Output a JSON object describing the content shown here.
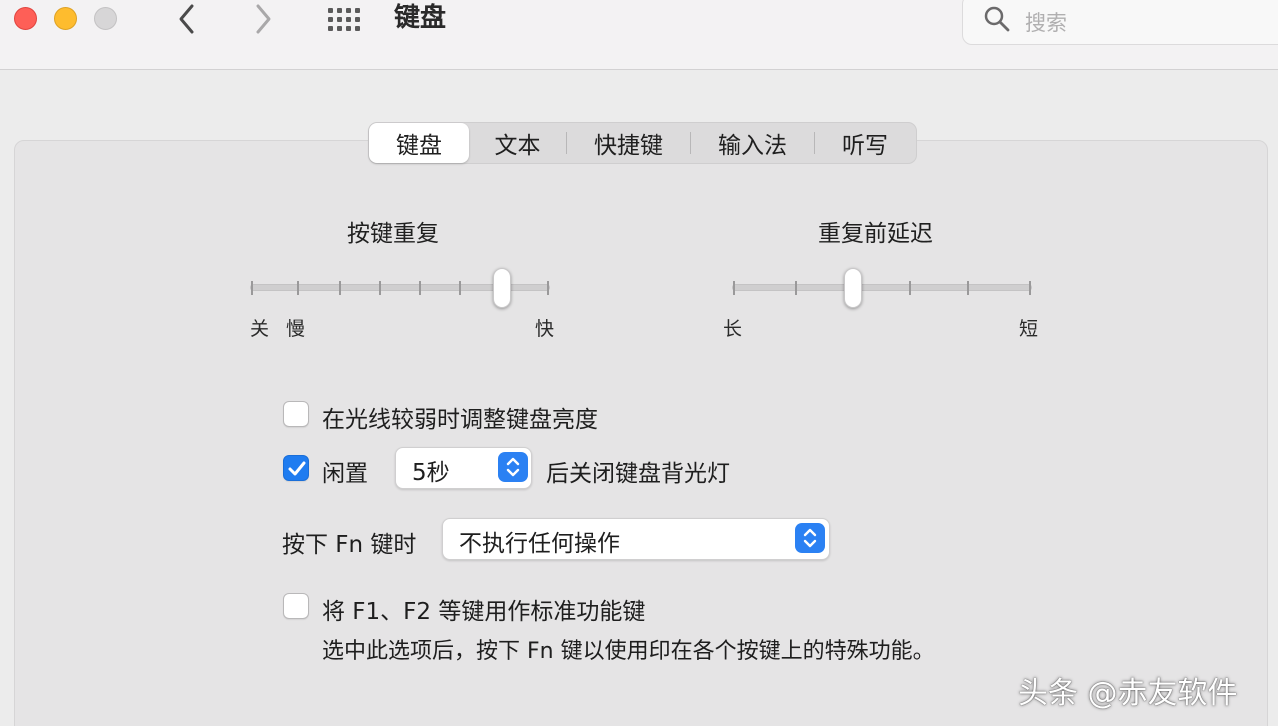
{
  "window": {
    "title": "键盘"
  },
  "search": {
    "placeholder": "搜索"
  },
  "tabs": [
    {
      "label": "键盘",
      "active": true
    },
    {
      "label": "文本",
      "active": false
    },
    {
      "label": "快捷键",
      "active": false
    },
    {
      "label": "输入法",
      "active": false
    },
    {
      "label": "听写",
      "active": false
    }
  ],
  "key_repeat": {
    "title": "按键重复",
    "min_label_off": "关",
    "min_label_slow": "慢",
    "max_label": "快",
    "position_fraction": 0.83
  },
  "delay_until_repeat": {
    "title": "重复前延迟",
    "min_label": "长",
    "max_label": "短",
    "position_fraction": 0.41
  },
  "options": {
    "adjust_brightness": {
      "label": "在光线较弱时调整键盘亮度",
      "checked": false
    },
    "turn_off_backlight": {
      "prefix": "闲置",
      "duration": "5秒",
      "suffix": "后关闭键盘背光灯",
      "checked": true
    },
    "fn_key": {
      "label": "按下 Fn 键时",
      "value": "不执行任何操作"
    },
    "standard_function_keys": {
      "label": "将 F1、F2 等键用作标准功能键",
      "description": "选中此选项后，按下 Fn 键以使用印在各个按键上的特殊功能。",
      "checked": false
    }
  },
  "watermark": "头条 @赤友软件",
  "colors": {
    "accent": "#1f7cf0",
    "close": "#fe5f57",
    "minimize": "#febc2e"
  }
}
